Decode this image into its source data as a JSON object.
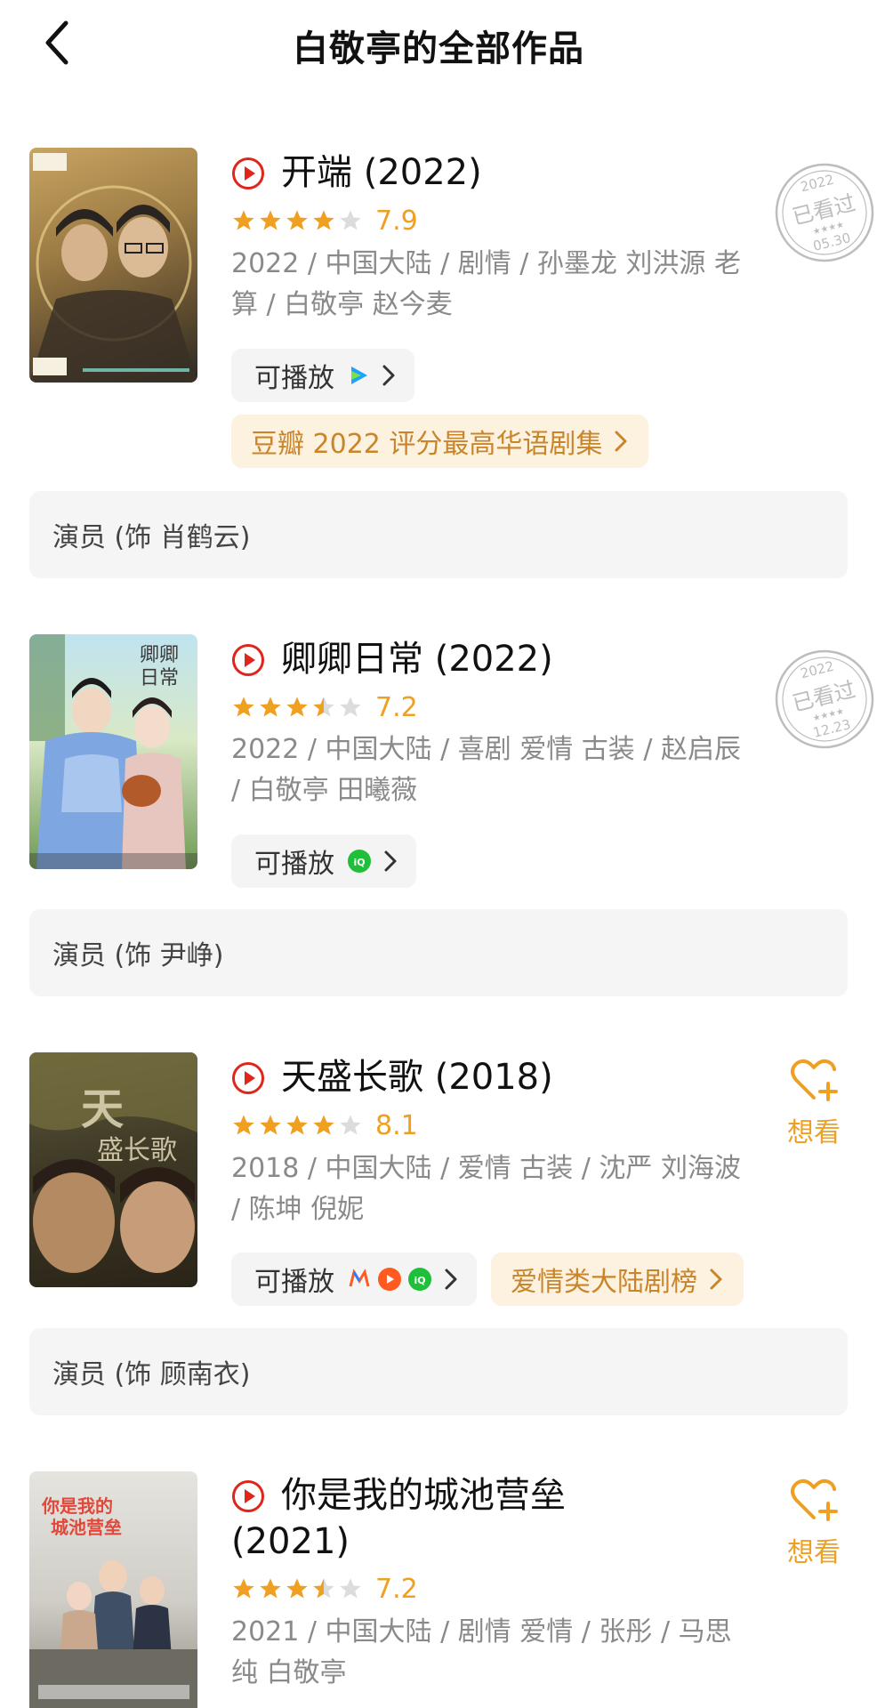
{
  "header": {
    "title": "白敬亭的全部作品",
    "back_icon": "chevron-left-icon"
  },
  "colors": {
    "accent": "#f0a020",
    "play_red": "#e0251b",
    "rank_text": "#c9852a",
    "meta_gray": "#8a8a8a"
  },
  "works": [
    {
      "title": "开端 (2022)",
      "rating": "7.9",
      "stars": 4,
      "meta": "2022 / 中国大陆 / 剧情 / 孙墨龙 刘洪源 老算 / 白敬亭 赵今麦",
      "play_label": "可播放",
      "platforms": [
        "tencent-video-icon"
      ],
      "rank_label": "豆瓣 2022 评分最高华语剧集",
      "role": "演员 (饰 肖鹤云)",
      "stamp": {
        "year": "2022",
        "text": "已看过",
        "date": "05.30"
      }
    },
    {
      "title": "卿卿日常 (2022)",
      "rating": "7.2",
      "stars": 3.5,
      "meta": "2022 / 中国大陆 / 喜剧 爱情 古装 / 赵启辰 / 白敬亭 田曦薇",
      "play_label": "可播放",
      "platforms": [
        "iqiyi-icon"
      ],
      "role": "演员 (饰 尹峥)",
      "stamp": {
        "year": "2022",
        "text": "已看过",
        "date": "12.23"
      }
    },
    {
      "title": "天盛长歌 (2018)",
      "rating": "8.1",
      "stars": 4,
      "meta": "2018 / 中国大陆 / 爱情 古装 / 沈严 刘海波 / 陈坤 倪妮",
      "play_label": "可播放",
      "platforms": [
        "mgtv-icon",
        "youku-icon",
        "iqiyi-icon"
      ],
      "rank_label": "爱情类大陆剧榜",
      "role": "演员 (饰 顾南衣)",
      "want_label": "想看"
    },
    {
      "title_line1": "你是我的城池营垒",
      "title_line2": "(2021)",
      "rating": "7.2",
      "stars": 3.5,
      "meta": "2021 / 中国大陆 / 剧情 爱情 / 张彤 / 马思纯 白敬亭",
      "want_label": "想看"
    }
  ]
}
